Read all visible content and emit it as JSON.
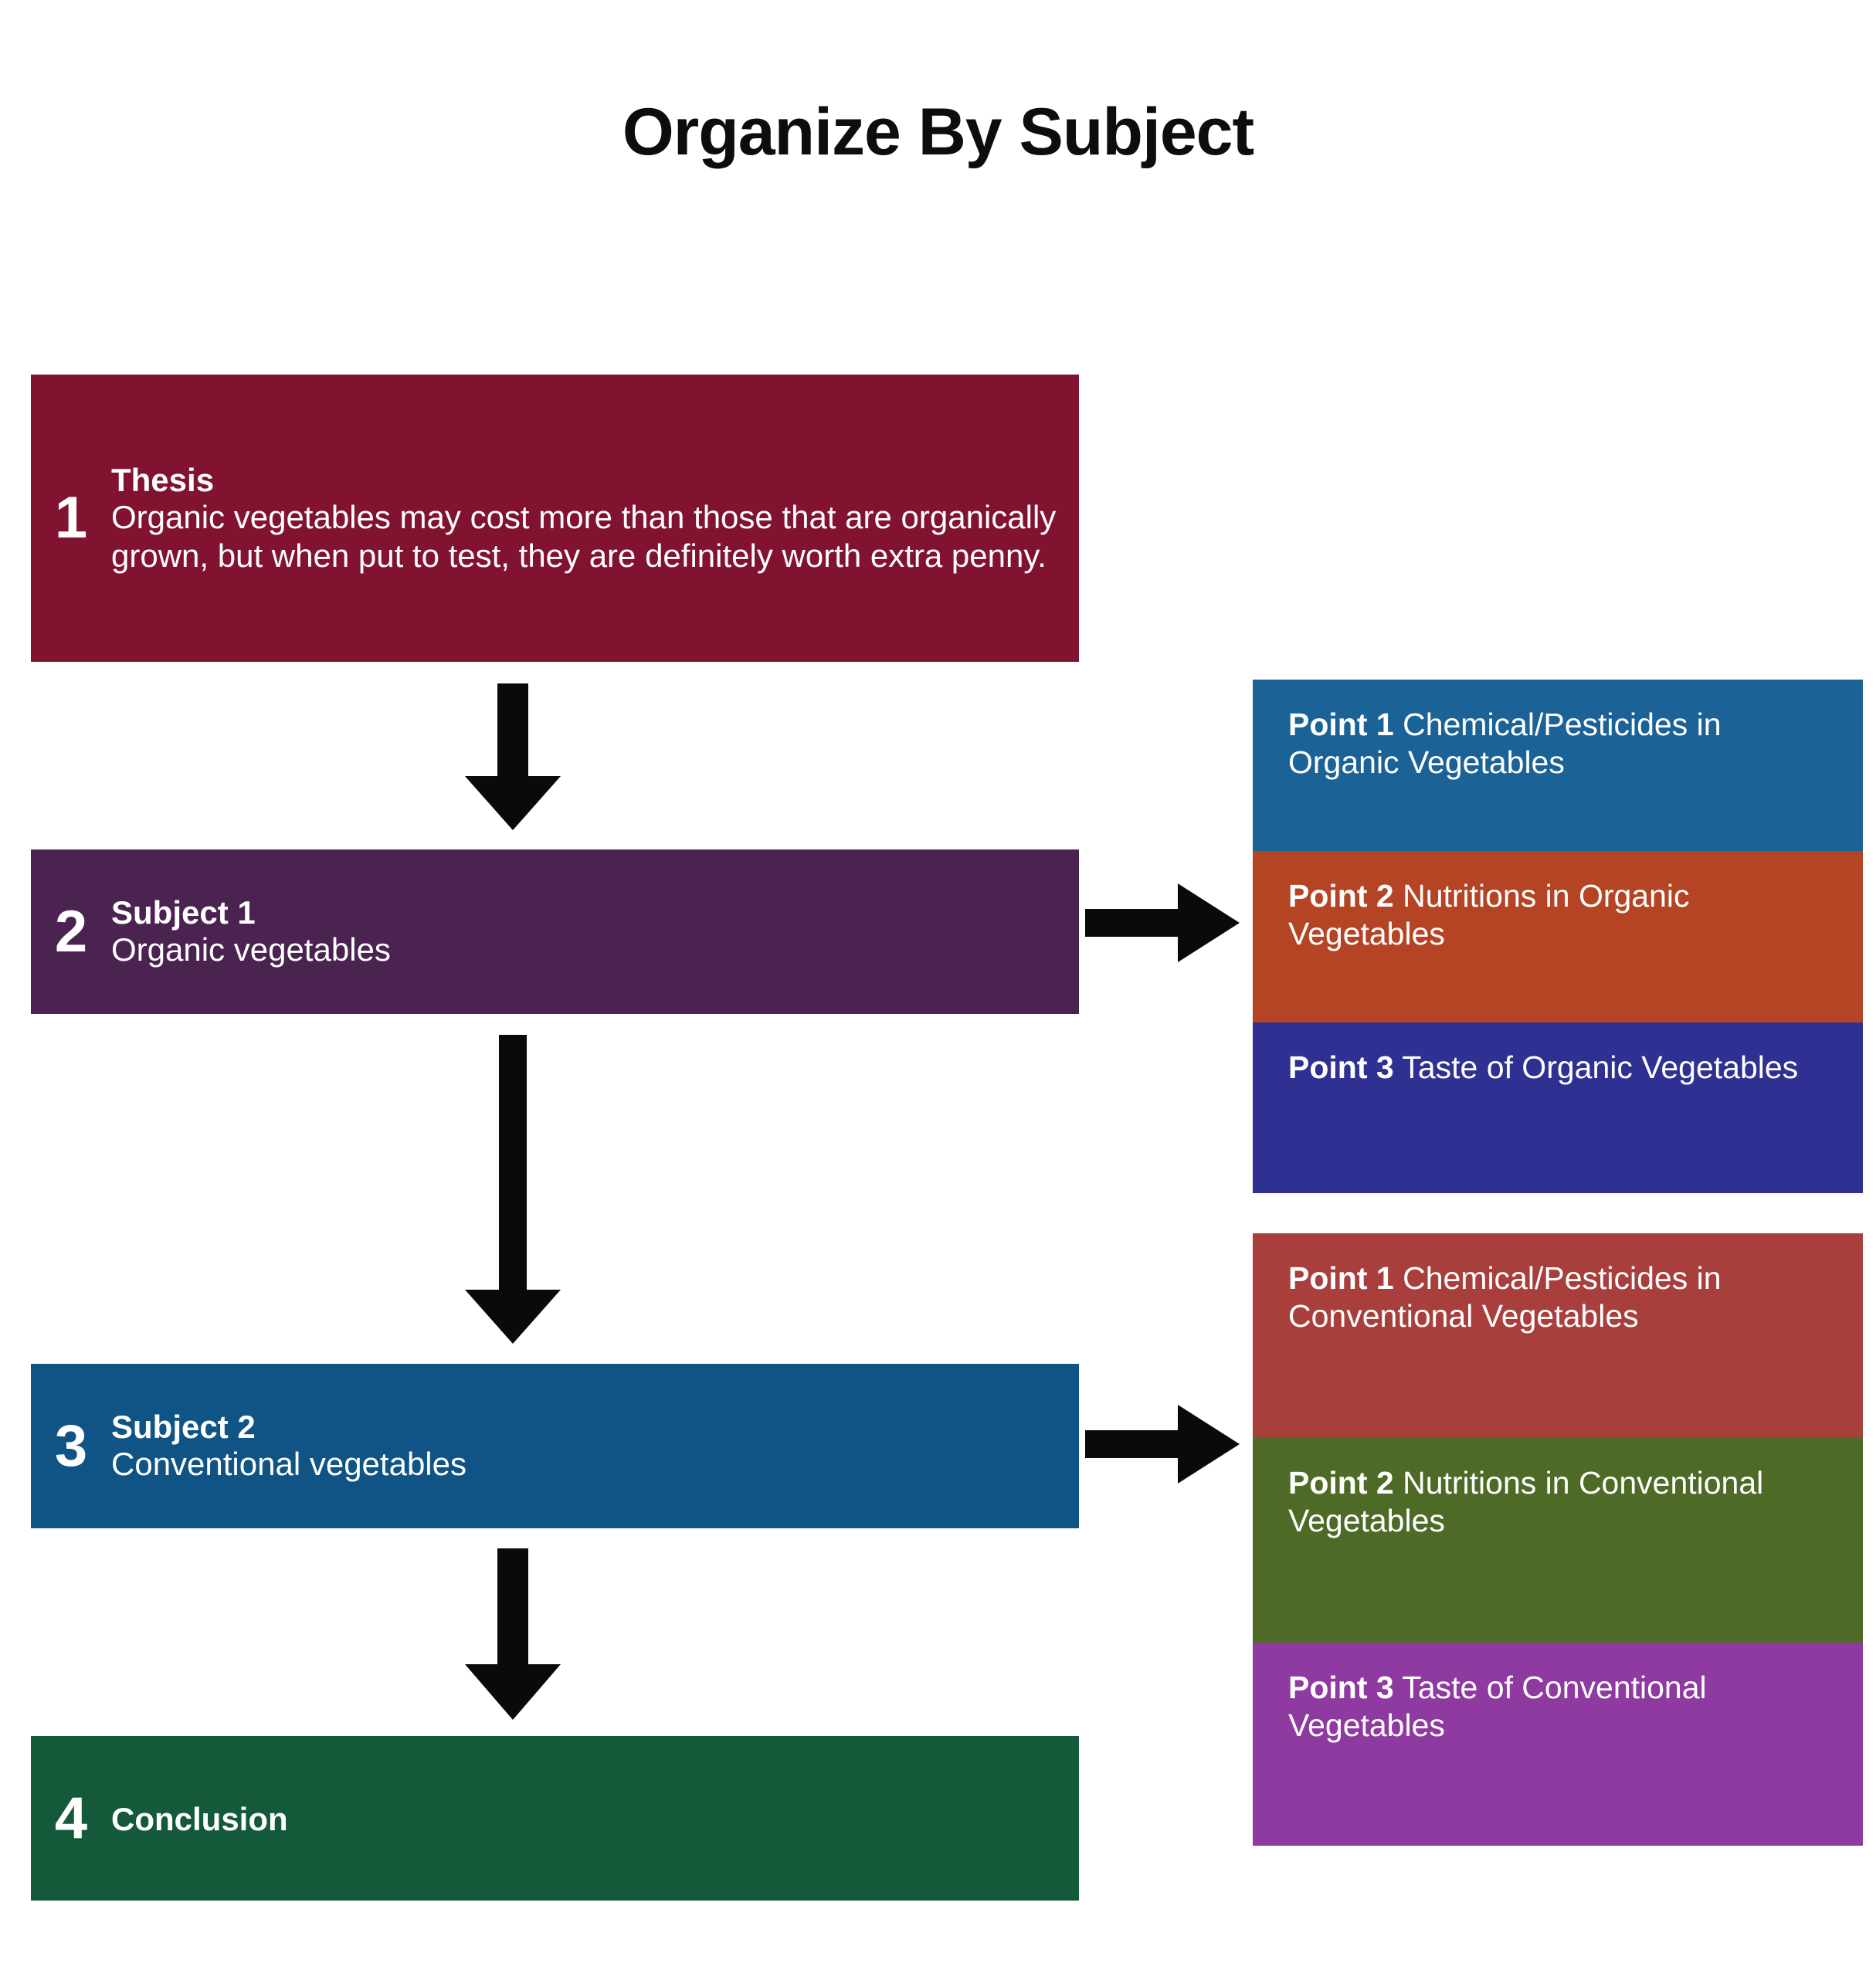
{
  "title": "Organize By Subject",
  "steps": [
    {
      "number": "1",
      "heading": "Thesis",
      "text": "Organic vegetables may cost more than those that are organically grown, but when put to test, they are definitely worth extra penny.",
      "color": "#811331"
    },
    {
      "number": "2",
      "heading": "Subject 1",
      "text": "Organic vegetables",
      "color": "#4A2350"
    },
    {
      "number": "3",
      "heading": "Subject 2",
      "text": "Conventional vegetables",
      "color": "#0F5484"
    },
    {
      "number": "4",
      "heading": "Conclusion",
      "text": "",
      "color": "#14593A"
    }
  ],
  "point_groups": [
    {
      "name": "Subject 1 points",
      "points": [
        {
          "label": "Point 1",
          "desc": " Chemical/Pesticides in Organic Vegetables",
          "color": "#1B6397"
        },
        {
          "label": "Point 2",
          "desc": " Nutritions in Organic Vegetables",
          "color": "#B44424"
        },
        {
          "label": "Point 3",
          "desc": " Taste of Organic Vegetables",
          "color": "#2E3192"
        }
      ]
    },
    {
      "name": "Subject 2 points",
      "points": [
        {
          "label": "Point 1",
          "desc": " Chemical/Pesticides in Conventional Vegetables",
          "color": "#A93F3C"
        },
        {
          "label": "Point 2",
          "desc": " Nutritions in Conventional  Vegetables",
          "color": "#4D6B27"
        },
        {
          "label": "Point 3",
          "desc": " Taste of Conventional Vegetables",
          "color": "#8E3AA0"
        }
      ]
    }
  ],
  "arrows": [
    {
      "name": "thesis-to-subject1",
      "direction": "down"
    },
    {
      "name": "subject1-to-subject2",
      "direction": "down"
    },
    {
      "name": "subject2-to-conclusion",
      "direction": "down"
    },
    {
      "name": "subject1-to-points",
      "direction": "right"
    },
    {
      "name": "subject2-to-points",
      "direction": "right"
    }
  ],
  "arrow_color": "#0a0a0a",
  "background": "#ffffff"
}
